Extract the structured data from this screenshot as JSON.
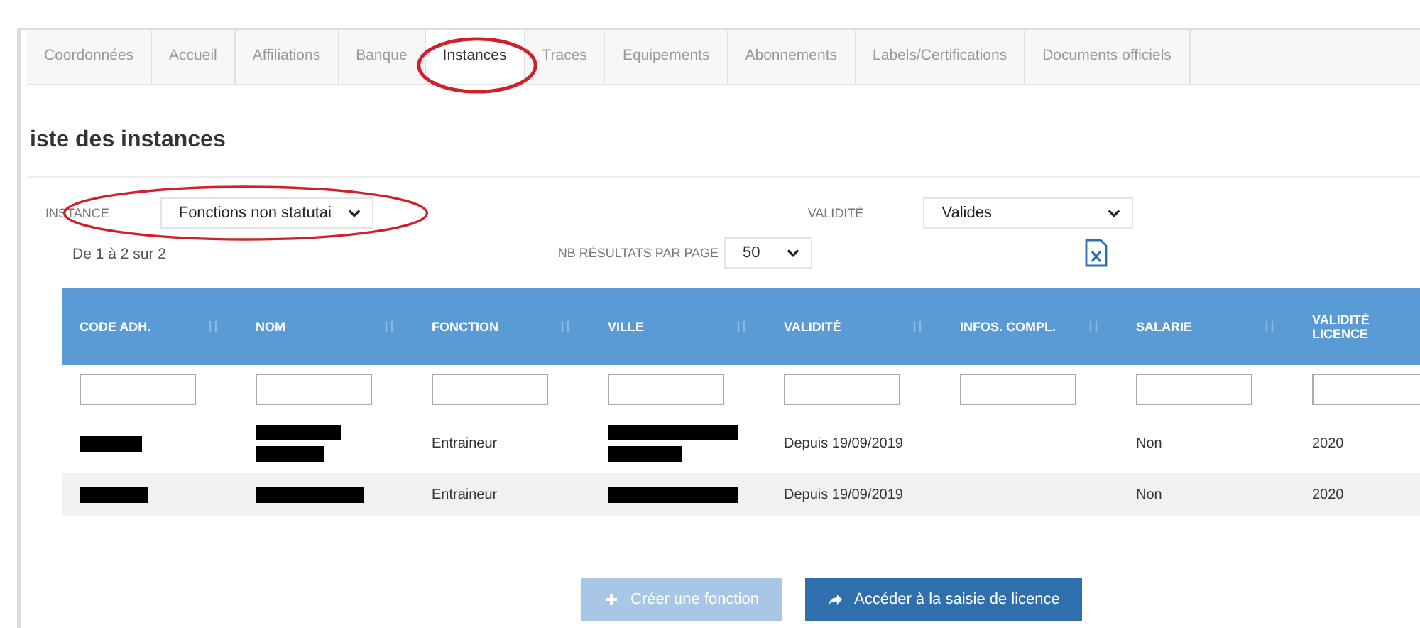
{
  "tabs": [
    {
      "label": "Coordonnées",
      "selected": false
    },
    {
      "label": "Accueil",
      "selected": false
    },
    {
      "label": "Affiliations",
      "selected": false
    },
    {
      "label": "Banque",
      "selected": false
    },
    {
      "label": "Instances",
      "selected": true,
      "circled": true
    },
    {
      "label": "Traces",
      "selected": false
    },
    {
      "label": "Equipements",
      "selected": false
    },
    {
      "label": "Abonnements",
      "selected": false
    },
    {
      "label": "Labels/Certifications",
      "selected": false
    },
    {
      "label": "Documents officiels",
      "selected": false
    }
  ],
  "heading": "iste des instances",
  "filters": {
    "instance": {
      "label": "INSTANCE",
      "value": "Fonctions non statutai",
      "circled": true
    },
    "validite": {
      "label": "VALIDITÉ",
      "value": "Valides"
    },
    "page_size": {
      "label": "NB RÉSULTATS PAR PAGE",
      "value": "50"
    },
    "count": "De 1 à 2 sur 2"
  },
  "table": {
    "columns": [
      {
        "label": "CODE ADH."
      },
      {
        "label": "NOM"
      },
      {
        "label": "FONCTION"
      },
      {
        "label": "VILLE"
      },
      {
        "label": "VALIDITÉ"
      },
      {
        "label": "INFOS. COMPL."
      },
      {
        "label": "SALARIE"
      },
      {
        "label": "VALIDITÉ LICENCE"
      }
    ],
    "rows": [
      {
        "cells": [
          {
            "kind": "redacted"
          },
          {
            "kind": "redacted2"
          },
          {
            "kind": "text",
            "text": "Entraineur"
          },
          {
            "kind": "redacted2"
          },
          {
            "kind": "text",
            "text": "Depuis 19/09/2019"
          },
          {
            "kind": "empty"
          },
          {
            "kind": "text",
            "text": "Non"
          },
          {
            "kind": "text",
            "text": "2020"
          }
        ]
      },
      {
        "cells": [
          {
            "kind": "redacted"
          },
          {
            "kind": "redacted"
          },
          {
            "kind": "text",
            "text": "Entraineur"
          },
          {
            "kind": "redacted"
          },
          {
            "kind": "text",
            "text": "Depuis 19/09/2019"
          },
          {
            "kind": "empty"
          },
          {
            "kind": "text",
            "text": "Non"
          },
          {
            "kind": "text",
            "text": "2020"
          }
        ]
      }
    ]
  },
  "buttons": [
    {
      "label": "Créer une fonction",
      "kind": "create",
      "disabled": true
    },
    {
      "label": "Accéder à la saisie de licence",
      "kind": "goto",
      "disabled": false
    }
  ]
}
